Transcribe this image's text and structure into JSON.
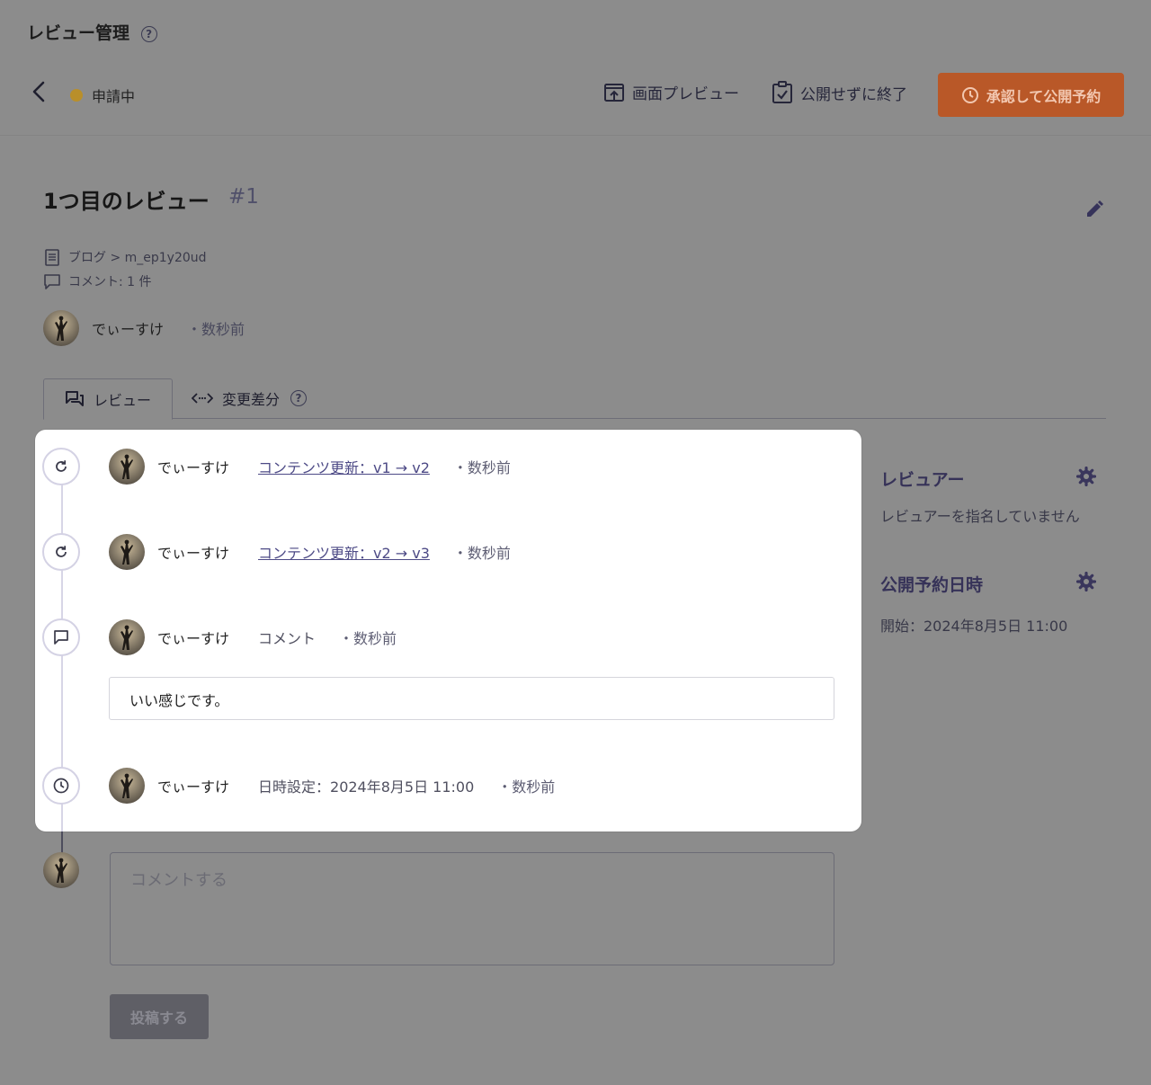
{
  "header": {
    "app_title": "レビュー管理",
    "status": "申請中",
    "preview_label": "画面プレビュー",
    "close_label": "公開せずに終了",
    "approve_label": "承認して公開予約"
  },
  "review": {
    "title": "1つ目のレビュー",
    "number": "#1",
    "content_path": "ブログ > m_ep1y20ud",
    "comment_count": "コメント: 1 件",
    "author": "でぃーすけ",
    "time": "・数秒前"
  },
  "tabs": [
    {
      "label": "レビュー"
    },
    {
      "label": "変更差分"
    }
  ],
  "timeline": [
    {
      "author": "でぃーすけ",
      "action": "コンテンツ更新：v1 → v2",
      "time": "・数秒前",
      "icon": "refresh-icon"
    },
    {
      "author": "でぃーすけ",
      "action": "コンテンツ更新：v2 → v3",
      "time": "・数秒前",
      "icon": "refresh-icon"
    },
    {
      "author": "でぃーすけ",
      "action": "コメント",
      "time": "・数秒前",
      "icon": "comment-icon",
      "comment": "いい感じです。"
    },
    {
      "author": "でぃーすけ",
      "action": "日時設定：2024年8月5日 11:00",
      "time": "・数秒前",
      "icon": "clock-icon"
    }
  ],
  "compose": {
    "placeholder": "コメントする",
    "post_label": "投稿する"
  },
  "sidebar": {
    "reviewer_heading": "レビュアー",
    "reviewer_text": "レビュアーを指名していません",
    "schedule_heading": "公開予約日時",
    "schedule_text": "開始：2024年8月5日 11:00"
  },
  "colors": {
    "overlay_bg": "#8c8c8c",
    "primary_button": "#b95828",
    "status_dot": "#b98f2a",
    "link": "#4d4a86"
  }
}
